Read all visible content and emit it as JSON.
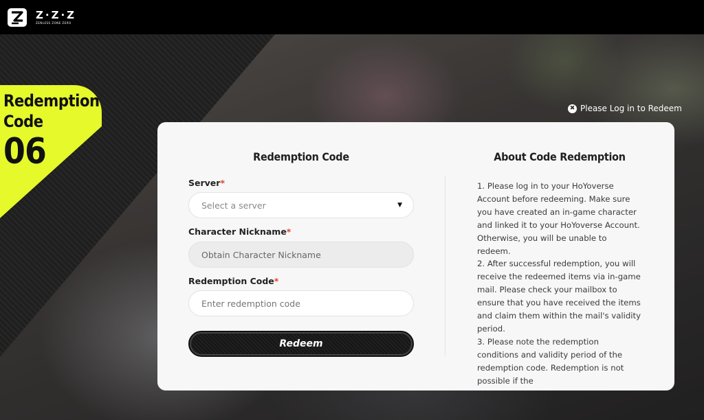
{
  "header": {
    "logo_title": "Z·Z·Z",
    "logo_subtitle": "ZENLESS ZONE ZERO"
  },
  "badge": {
    "line1": "Redemption",
    "line2": "Code",
    "number": "06"
  },
  "login": {
    "label": "Please Log in to Redeem"
  },
  "form": {
    "title": "Redemption Code",
    "server_label": "Server",
    "server_placeholder": "Select a server",
    "nickname_label": "Character Nickname",
    "nickname_placeholder": "Obtain Character Nickname",
    "code_label": "Redemption Code",
    "code_placeholder": "Enter redemption code",
    "redeem_label": "Redeem",
    "required_mark": "*"
  },
  "about": {
    "title": "About Code Redemption",
    "paragraphs": [
      "1. Please log in to your HoYoverse Account before redeeming. Make sure you have created an in-game character and linked it to your HoYoverse Account. Otherwise, you will be unable to redeem.",
      "2. After successful redemption, you will receive the redeemed items via in-game mail. Please check your mailbox to ensure that you have received the items and claim them within the mail's validity period.",
      "3. Please note the redemption conditions and validity period of the redemption code. Redemption is not possible if the"
    ]
  },
  "colors": {
    "accent_yellow": "#e5f92b",
    "required_red": "#e2452b"
  }
}
